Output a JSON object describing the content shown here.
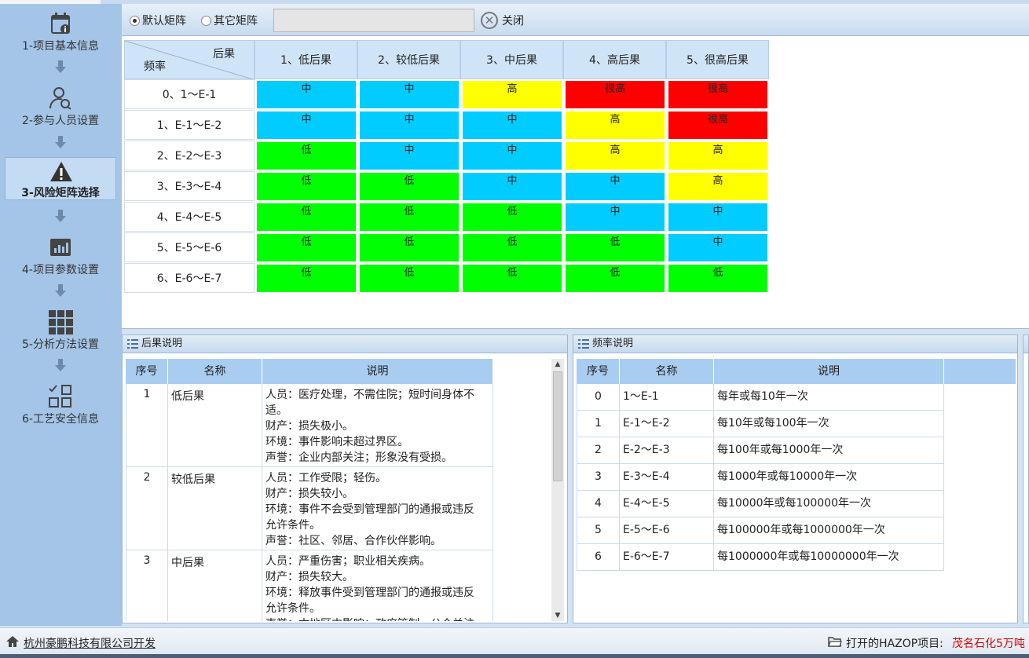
{
  "sidebar": {
    "steps": [
      {
        "label": "1-项目基本信息",
        "icon": "info-calendar-icon"
      },
      {
        "label": "2-参与人员设置",
        "icon": "user-search-icon"
      },
      {
        "label": "3-风险矩阵选择",
        "icon": "warning-icon",
        "active": true
      },
      {
        "label": "4-项目参数设置",
        "icon": "bar-chart-icon"
      },
      {
        "label": "5-分析方法设置",
        "icon": "grid-icon"
      },
      {
        "label": "6-工艺安全信息",
        "icon": "apps-check-icon"
      }
    ]
  },
  "toolbar": {
    "radio_default": "默认矩阵",
    "radio_other": "其它矩阵",
    "selected": "默认矩阵",
    "combo_value": "",
    "close_label": "关闭"
  },
  "matrix": {
    "corner_top": "后果",
    "corner_bottom": "频率",
    "columns": [
      "1、低后果",
      "2、较低后果",
      "3、中后果",
      "4、高后果",
      "5、很高后果"
    ],
    "rows": [
      {
        "label": "0、1～E-1",
        "cells": [
          "中",
          "中",
          "高",
          "很高",
          "很高"
        ]
      },
      {
        "label": "1、E-1～E-2",
        "cells": [
          "中",
          "中",
          "中",
          "高",
          "很高"
        ]
      },
      {
        "label": "2、E-2～E-3",
        "cells": [
          "低",
          "中",
          "中",
          "高",
          "高"
        ]
      },
      {
        "label": "3、E-3～E-4",
        "cells": [
          "低",
          "低",
          "中",
          "中",
          "高"
        ]
      },
      {
        "label": "4、E-4～E-5",
        "cells": [
          "低",
          "低",
          "低",
          "中",
          "中"
        ]
      },
      {
        "label": "5、E-5～E-6",
        "cells": [
          "低",
          "低",
          "低",
          "低",
          "中"
        ]
      },
      {
        "label": "6、E-6～E-7",
        "cells": [
          "低",
          "低",
          "低",
          "低",
          "低"
        ]
      }
    ],
    "level_colors": {
      "低": "#00ff00",
      "中": "#00ccff",
      "高": "#ffff00",
      "很高": "#ff0000"
    }
  },
  "consequence_panel": {
    "title": "后果说明",
    "headers": [
      "序号",
      "名称",
      "说明"
    ],
    "rows": [
      {
        "id": "1",
        "name": "低后果",
        "lines": [
          "人员：医疗处理，不需住院；短时间身体不",
          "适。",
          "财产：损失极小。",
          "环境：事件影响未超过界区。",
          "声誉：企业内部关注；形象没有受损。"
        ]
      },
      {
        "id": "2",
        "name": "较低后果",
        "lines": [
          "人员：工作受限；轻伤。",
          "财产：损失较小。",
          "环境：事件不会受到管理部门的通报或违反",
          "允许条件。",
          "声誉：社区、邻居、合作伙伴影响。"
        ]
      },
      {
        "id": "3",
        "name": "中后果",
        "lines": [
          "人员：严重伤害；职业相关疾病。",
          "财产：损失较大。",
          "环境：释放事件受到管理部门的通报或违反",
          "允许条件。",
          "声誉：本地区内影响；政府管制，公众关注"
        ]
      }
    ]
  },
  "frequency_panel": {
    "title": "频率说明",
    "headers": [
      "序号",
      "名称",
      "说明"
    ],
    "rows": [
      {
        "id": "0",
        "name": "1～E-1",
        "desc": "每年或每10年一次"
      },
      {
        "id": "1",
        "name": "E-1～E-2",
        "desc": "每10年或每100年一次"
      },
      {
        "id": "2",
        "name": "E-2～E-3",
        "desc": "每100年或每1000年一次"
      },
      {
        "id": "3",
        "name": "E-3～E-4",
        "desc": "每1000年或每10000年一次"
      },
      {
        "id": "4",
        "name": "E-4～E-5",
        "desc": "每10000年或每100000年一次"
      },
      {
        "id": "5",
        "name": "E-5～E-6",
        "desc": "每100000年或每1000000年一次"
      },
      {
        "id": "6",
        "name": "E-6～E-7",
        "desc": "每1000000年或每10000000年一次"
      }
    ]
  },
  "statusbar": {
    "company": "杭州豪鹏科技有限公司开发",
    "open_project_label": "打开的HAZOP项目:",
    "project_name": "茂名石化5万吨"
  }
}
